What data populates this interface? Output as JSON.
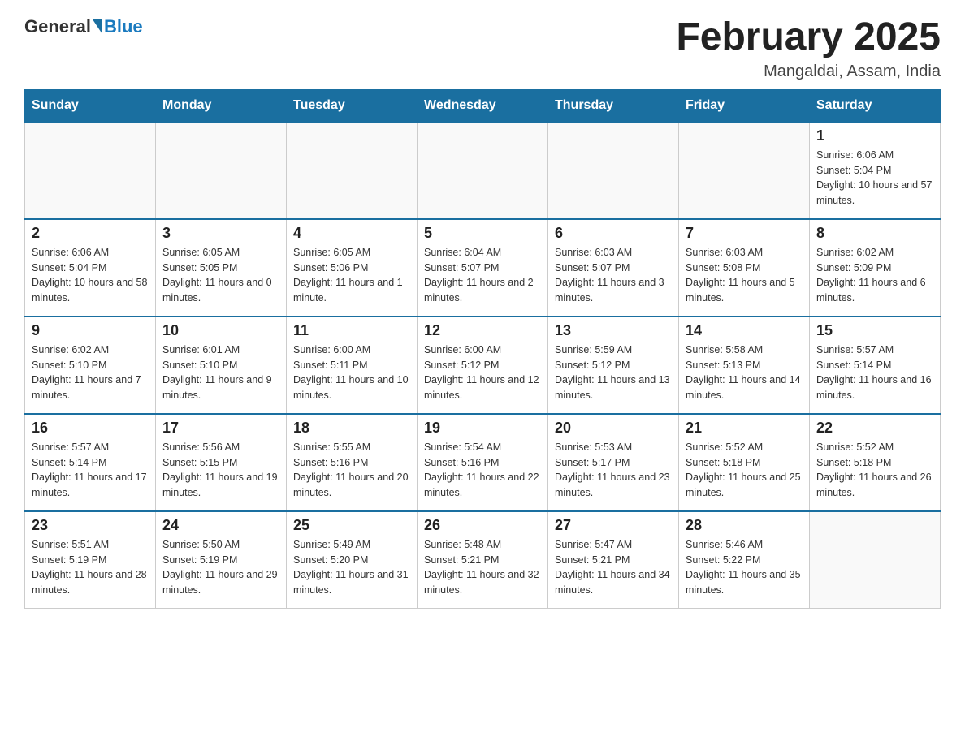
{
  "header": {
    "logo_general": "General",
    "logo_blue": "Blue",
    "month_title": "February 2025",
    "location": "Mangaldai, Assam, India"
  },
  "days_of_week": [
    "Sunday",
    "Monday",
    "Tuesday",
    "Wednesday",
    "Thursday",
    "Friday",
    "Saturday"
  ],
  "weeks": [
    [
      {
        "day": "",
        "info": ""
      },
      {
        "day": "",
        "info": ""
      },
      {
        "day": "",
        "info": ""
      },
      {
        "day": "",
        "info": ""
      },
      {
        "day": "",
        "info": ""
      },
      {
        "day": "",
        "info": ""
      },
      {
        "day": "1",
        "info": "Sunrise: 6:06 AM\nSunset: 5:04 PM\nDaylight: 10 hours and 57 minutes."
      }
    ],
    [
      {
        "day": "2",
        "info": "Sunrise: 6:06 AM\nSunset: 5:04 PM\nDaylight: 10 hours and 58 minutes."
      },
      {
        "day": "3",
        "info": "Sunrise: 6:05 AM\nSunset: 5:05 PM\nDaylight: 11 hours and 0 minutes."
      },
      {
        "day": "4",
        "info": "Sunrise: 6:05 AM\nSunset: 5:06 PM\nDaylight: 11 hours and 1 minute."
      },
      {
        "day": "5",
        "info": "Sunrise: 6:04 AM\nSunset: 5:07 PM\nDaylight: 11 hours and 2 minutes."
      },
      {
        "day": "6",
        "info": "Sunrise: 6:03 AM\nSunset: 5:07 PM\nDaylight: 11 hours and 3 minutes."
      },
      {
        "day": "7",
        "info": "Sunrise: 6:03 AM\nSunset: 5:08 PM\nDaylight: 11 hours and 5 minutes."
      },
      {
        "day": "8",
        "info": "Sunrise: 6:02 AM\nSunset: 5:09 PM\nDaylight: 11 hours and 6 minutes."
      }
    ],
    [
      {
        "day": "9",
        "info": "Sunrise: 6:02 AM\nSunset: 5:10 PM\nDaylight: 11 hours and 7 minutes."
      },
      {
        "day": "10",
        "info": "Sunrise: 6:01 AM\nSunset: 5:10 PM\nDaylight: 11 hours and 9 minutes."
      },
      {
        "day": "11",
        "info": "Sunrise: 6:00 AM\nSunset: 5:11 PM\nDaylight: 11 hours and 10 minutes."
      },
      {
        "day": "12",
        "info": "Sunrise: 6:00 AM\nSunset: 5:12 PM\nDaylight: 11 hours and 12 minutes."
      },
      {
        "day": "13",
        "info": "Sunrise: 5:59 AM\nSunset: 5:12 PM\nDaylight: 11 hours and 13 minutes."
      },
      {
        "day": "14",
        "info": "Sunrise: 5:58 AM\nSunset: 5:13 PM\nDaylight: 11 hours and 14 minutes."
      },
      {
        "day": "15",
        "info": "Sunrise: 5:57 AM\nSunset: 5:14 PM\nDaylight: 11 hours and 16 minutes."
      }
    ],
    [
      {
        "day": "16",
        "info": "Sunrise: 5:57 AM\nSunset: 5:14 PM\nDaylight: 11 hours and 17 minutes."
      },
      {
        "day": "17",
        "info": "Sunrise: 5:56 AM\nSunset: 5:15 PM\nDaylight: 11 hours and 19 minutes."
      },
      {
        "day": "18",
        "info": "Sunrise: 5:55 AM\nSunset: 5:16 PM\nDaylight: 11 hours and 20 minutes."
      },
      {
        "day": "19",
        "info": "Sunrise: 5:54 AM\nSunset: 5:16 PM\nDaylight: 11 hours and 22 minutes."
      },
      {
        "day": "20",
        "info": "Sunrise: 5:53 AM\nSunset: 5:17 PM\nDaylight: 11 hours and 23 minutes."
      },
      {
        "day": "21",
        "info": "Sunrise: 5:52 AM\nSunset: 5:18 PM\nDaylight: 11 hours and 25 minutes."
      },
      {
        "day": "22",
        "info": "Sunrise: 5:52 AM\nSunset: 5:18 PM\nDaylight: 11 hours and 26 minutes."
      }
    ],
    [
      {
        "day": "23",
        "info": "Sunrise: 5:51 AM\nSunset: 5:19 PM\nDaylight: 11 hours and 28 minutes."
      },
      {
        "day": "24",
        "info": "Sunrise: 5:50 AM\nSunset: 5:19 PM\nDaylight: 11 hours and 29 minutes."
      },
      {
        "day": "25",
        "info": "Sunrise: 5:49 AM\nSunset: 5:20 PM\nDaylight: 11 hours and 31 minutes."
      },
      {
        "day": "26",
        "info": "Sunrise: 5:48 AM\nSunset: 5:21 PM\nDaylight: 11 hours and 32 minutes."
      },
      {
        "day": "27",
        "info": "Sunrise: 5:47 AM\nSunset: 5:21 PM\nDaylight: 11 hours and 34 minutes."
      },
      {
        "day": "28",
        "info": "Sunrise: 5:46 AM\nSunset: 5:22 PM\nDaylight: 11 hours and 35 minutes."
      },
      {
        "day": "",
        "info": ""
      }
    ]
  ]
}
